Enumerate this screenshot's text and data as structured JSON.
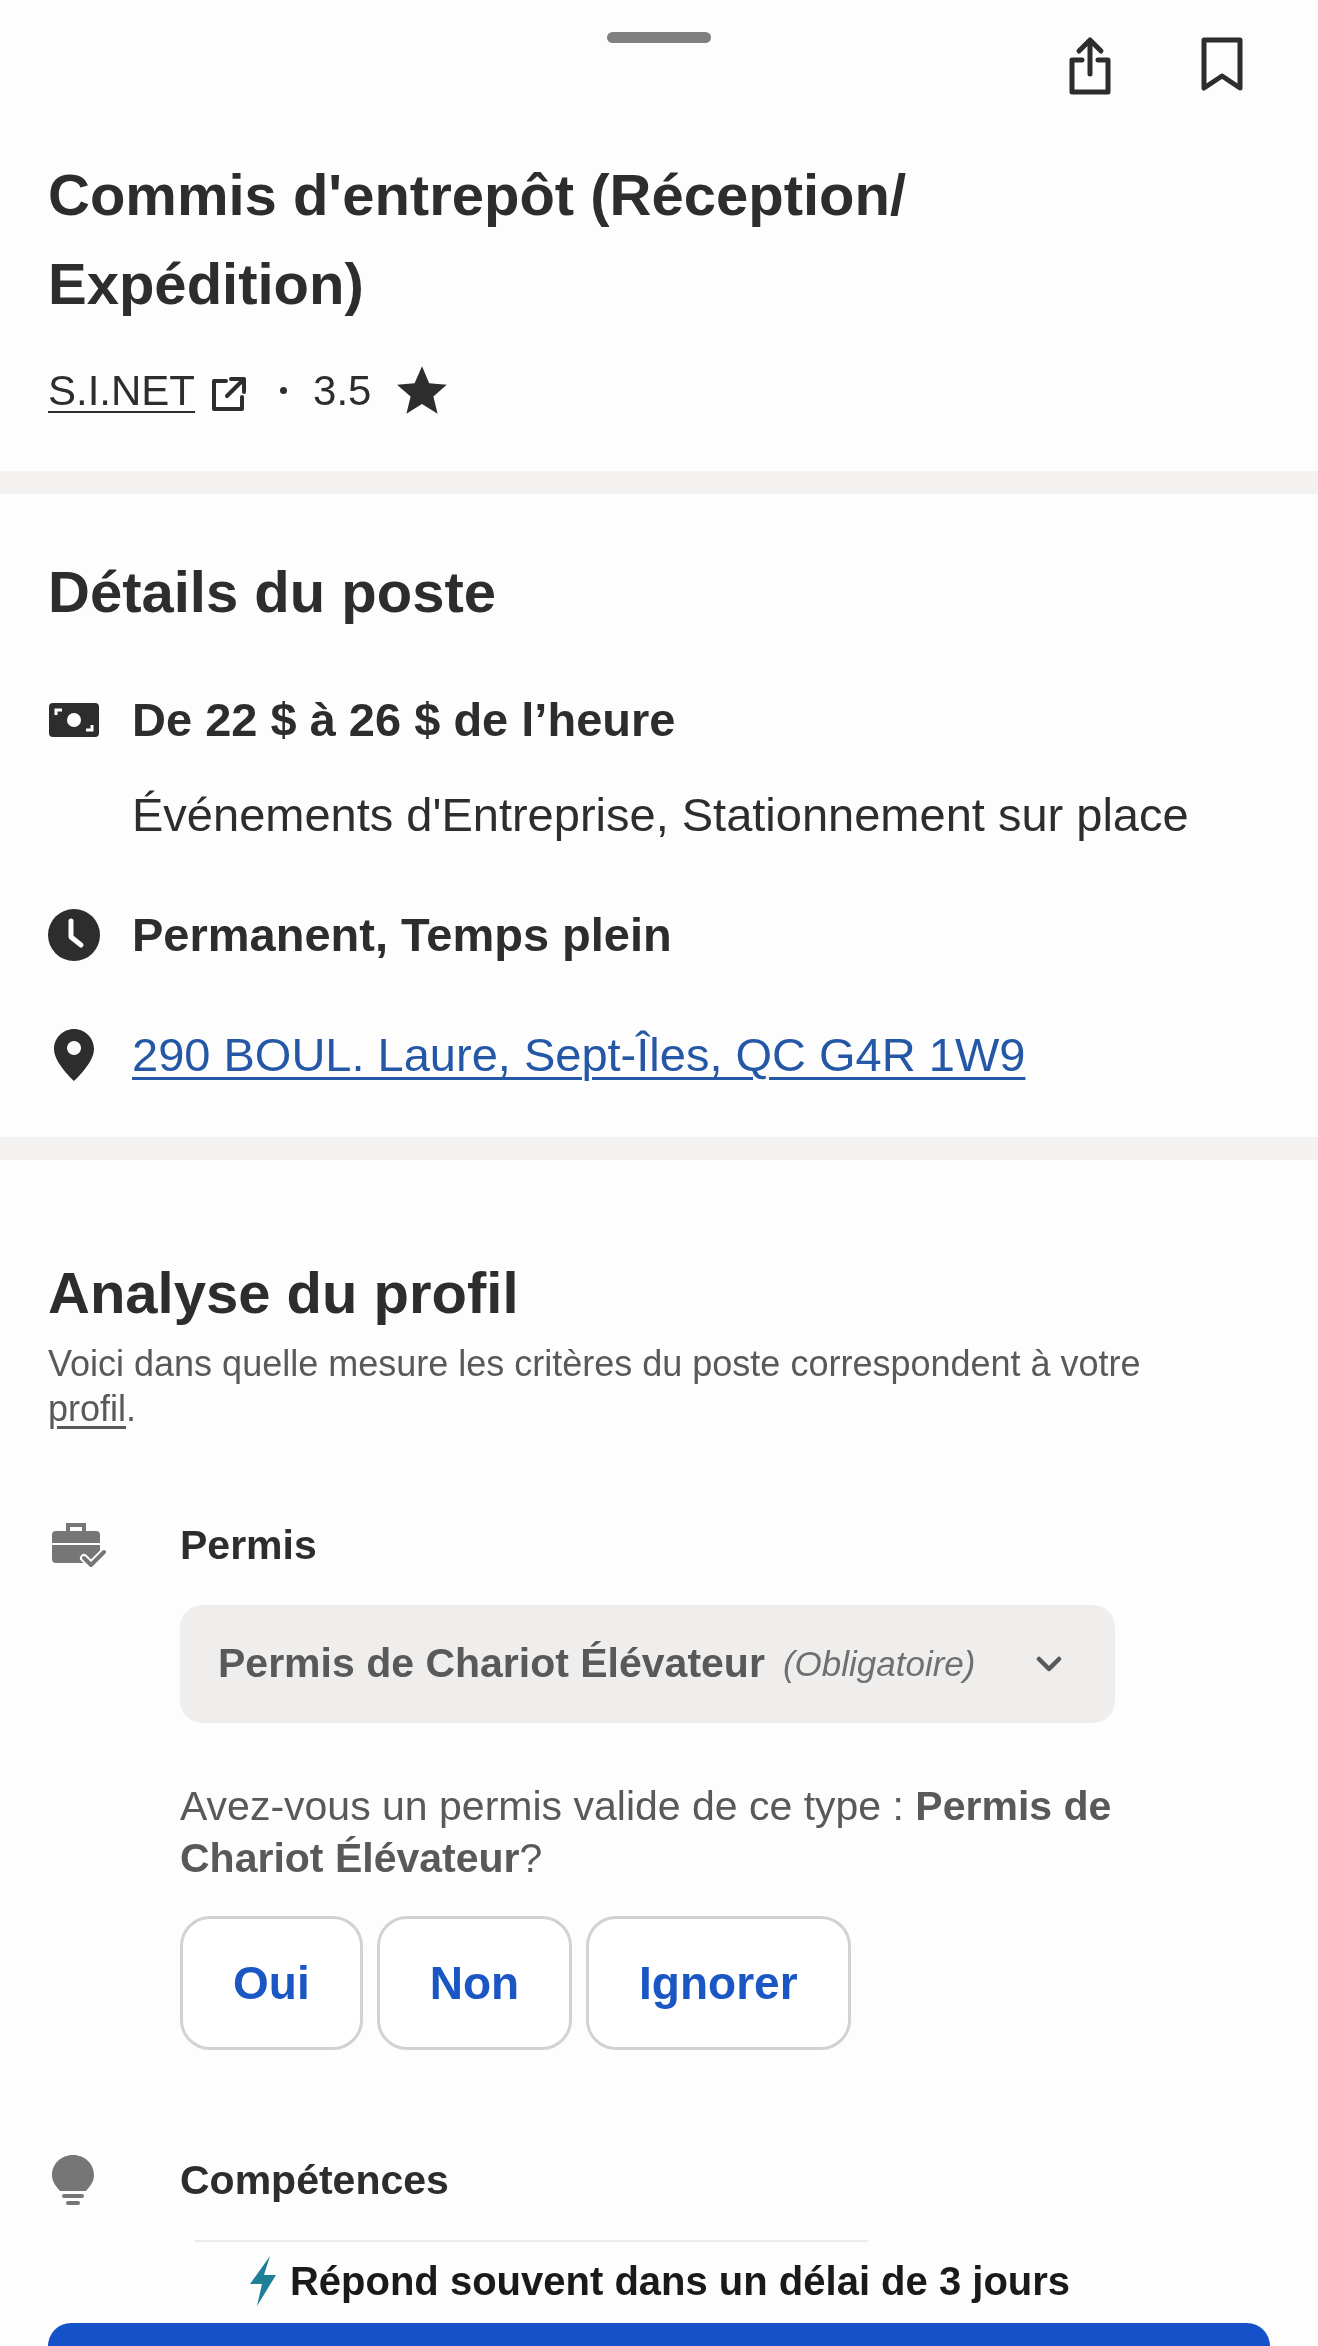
{
  "header": {
    "title": "Commis d'entrepôt (Réception/Expédition)",
    "company": "S.I.NET",
    "rating": "3.5"
  },
  "details": {
    "heading": "Détails du poste",
    "items": [
      {
        "kind": "pay",
        "text": "De 22 $ à 26 $ de l’heure",
        "note": "Événements d'Entreprise, Stationnement sur place"
      },
      {
        "kind": "schedule",
        "text": "Permanent, Temps plein"
      },
      {
        "kind": "location",
        "text": "290 BOUL. Laure, Sept-Îles, QC G4R 1W9"
      }
    ]
  },
  "profile": {
    "heading": "Analyse du profil",
    "description": {
      "text": "Voici dans quelle mesure les critères du poste correspondent à votre",
      "link": "profil",
      "end": "."
    },
    "criteria": [
      {
        "kind": "license",
        "label": "Permis",
        "select": {
          "value": "Permis de Chariot Élévateur",
          "tag": "(Obligatoire)",
          "expanded": false
        },
        "question": "Avez-vous un permis valide de ce type : **Permis de Chariot Élévateur**?",
        "answers": [
          {
            "label": "Oui",
            "selected": false
          },
          {
            "label": "Non",
            "selected": false
          },
          {
            "label": "Ignorer",
            "selected": false
          }
        ]
      },
      {
        "kind": "skills",
        "label": "Compétences"
      }
    ]
  },
  "footer": {
    "note": "Répond souvent dans un délai de 3 jours"
  }
}
